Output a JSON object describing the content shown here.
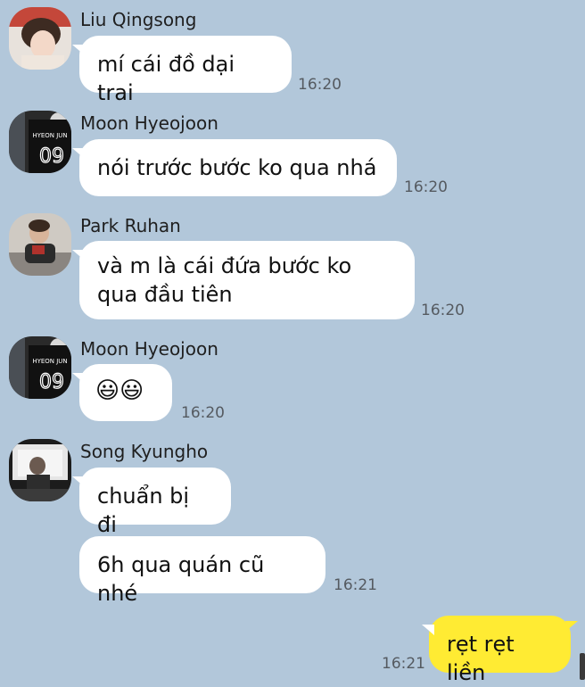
{
  "messages": [
    {
      "sender": "Liu Qingsong",
      "lines": [
        "mí cái đồ dại trai"
      ],
      "time": "16:20",
      "avatar_icon": "profile-photo-icon"
    },
    {
      "sender": "Moon Hyeojoon",
      "lines": [
        "nói trước bước ko qua nhá"
      ],
      "time": "16:20",
      "avatar_icon": "jersey-09-icon",
      "jersey_text": "HYEON JUN",
      "jersey_number": "09"
    },
    {
      "sender": "Park Ruhan",
      "lines": [
        "và m là cái đứa bước ko",
        "qua đầu tiên"
      ],
      "time": "16:20",
      "avatar_icon": "profile-photo-icon"
    },
    {
      "sender": "Moon Hyeojoon",
      "lines": [
        "😃😃"
      ],
      "time": "16:20",
      "avatar_icon": "jersey-09-icon",
      "jersey_text": "HYEON JUN",
      "jersey_number": "09"
    },
    {
      "sender": "Song Kyungho",
      "lines": [
        "chuẩn bị đi"
      ],
      "time": "",
      "avatar_icon": "profile-photo-icon"
    },
    {
      "sender": "Song Kyungho",
      "lines": [
        "6h qua quán cũ nhé"
      ],
      "time": "16:21",
      "avatar_icon": ""
    },
    {
      "sender": "me",
      "lines": [
        "rẹt rẹt liền"
      ],
      "time": "16:21",
      "avatar_icon": ""
    }
  ],
  "colors": {
    "background": "#b2c7da",
    "incoming_bubble": "#ffffff",
    "outgoing_bubble": "#ffeb33"
  }
}
